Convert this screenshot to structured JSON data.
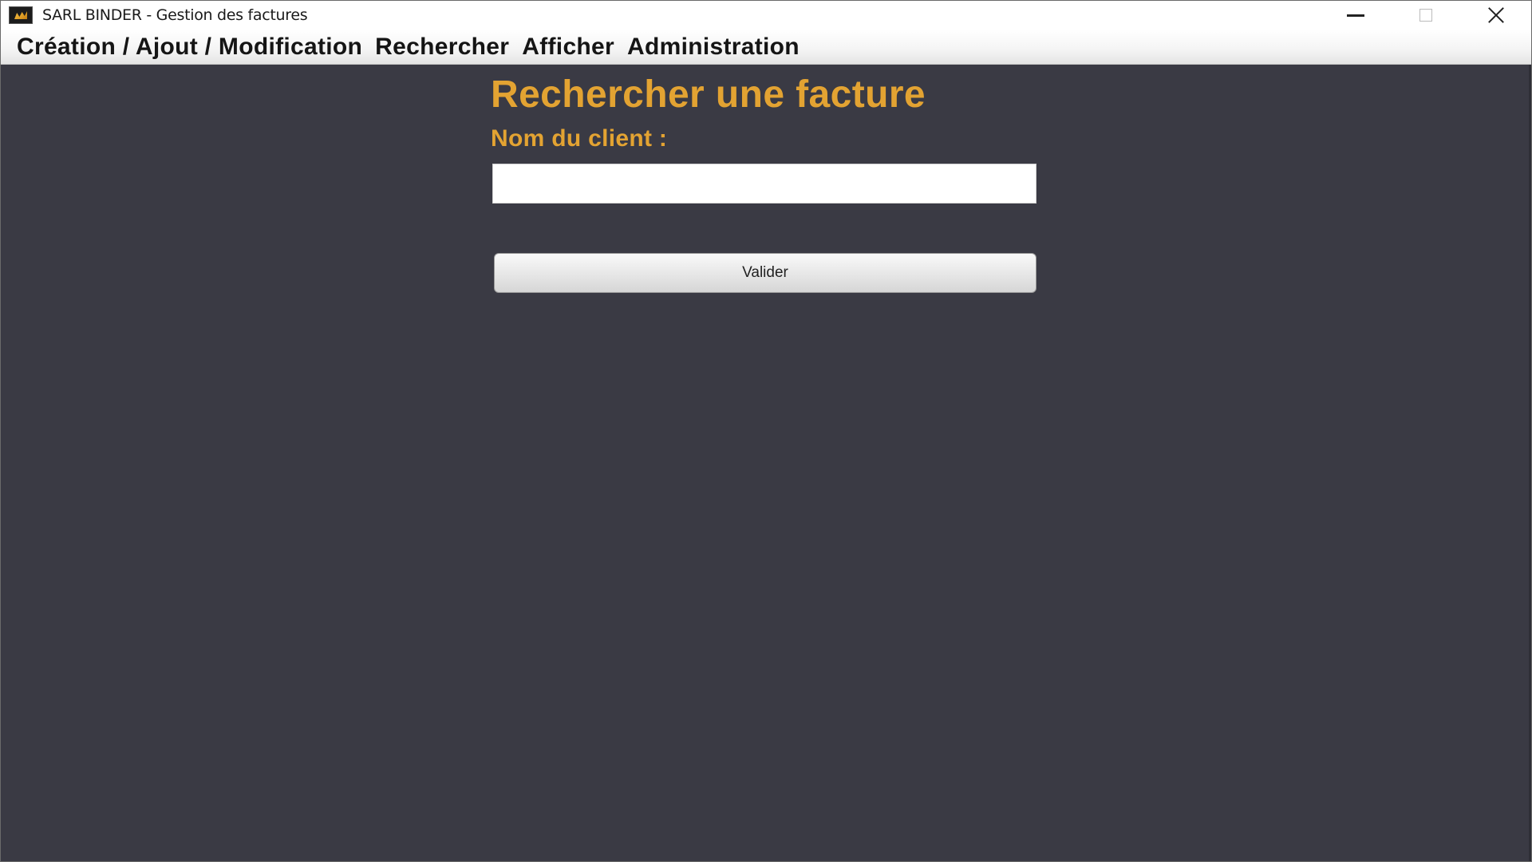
{
  "window": {
    "title": "SARL BINDER - Gestion des factures",
    "controls": [
      "minimize-icon",
      "maximize-icon",
      "close-icon"
    ]
  },
  "menubar": {
    "items": [
      {
        "label": "Création / Ajout / Modification"
      },
      {
        "label": "Rechercher"
      },
      {
        "label": "Afficher"
      },
      {
        "label": "Administration"
      }
    ]
  },
  "form": {
    "title": "Rechercher une facture",
    "client_label": "Nom du client :",
    "client_value": "",
    "submit_label": "Valider"
  },
  "colors": {
    "accent": "#e3a332",
    "background": "#3a3a44",
    "menubar": "#f4f4f4"
  }
}
